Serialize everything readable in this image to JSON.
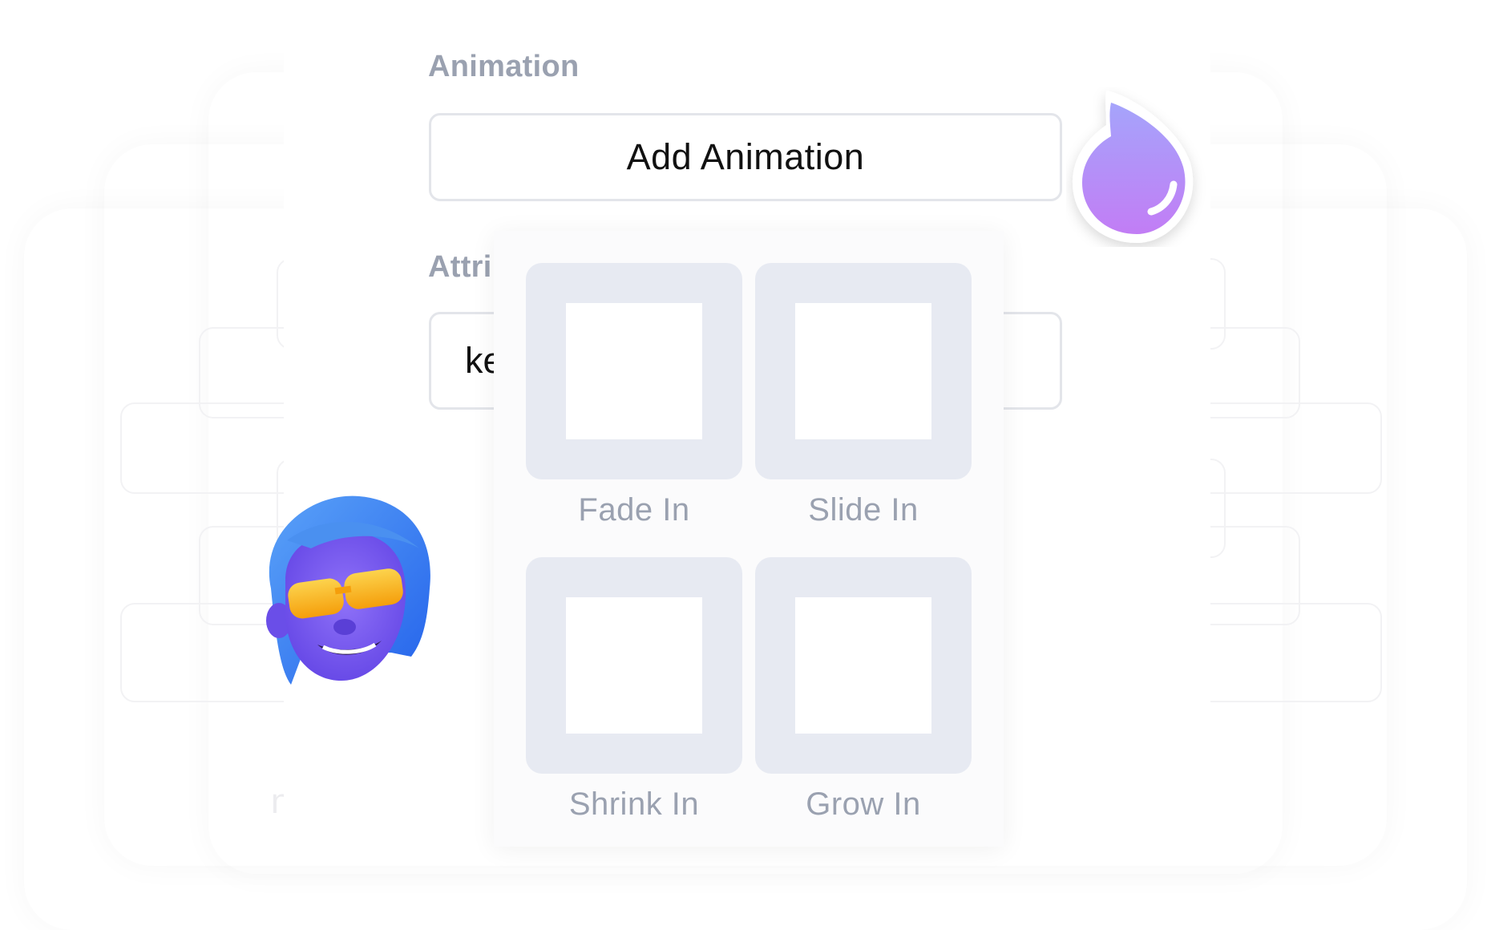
{
  "sections": {
    "animation_label": "Animation",
    "attributes_label": "Attri"
  },
  "add_animation_button": "Add Animation",
  "attribute_input_value": "ke",
  "animation_options": [
    {
      "label": "Fade In"
    },
    {
      "label": "Slide In"
    },
    {
      "label": "Shrink In"
    },
    {
      "label": "Grow In"
    }
  ],
  "colors": {
    "label_gray": "#9aa1b0",
    "thumb_bg": "#e7eaf2",
    "flame_gradient_start": "#a78bfa",
    "flame_gradient_end": "#c084fc",
    "avatar_hair": "#3b82f6",
    "avatar_face": "#7c5cf0",
    "avatar_glasses": "#fbbf24"
  },
  "icons": {
    "flame": "flame-icon",
    "avatar": "memoji-avatar"
  }
}
